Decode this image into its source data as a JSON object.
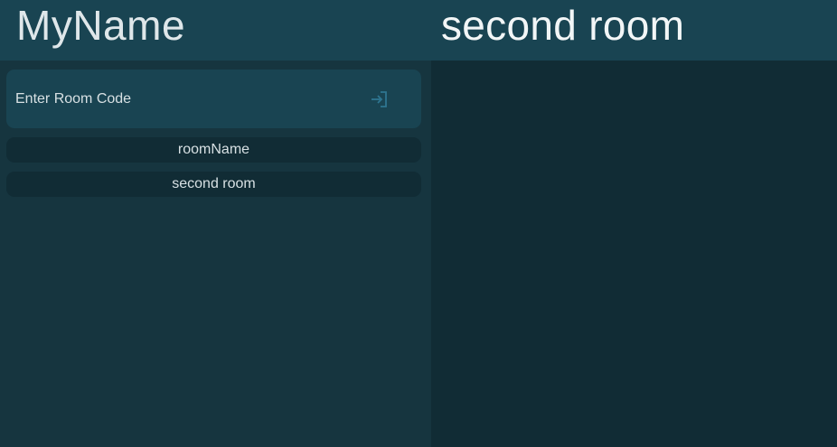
{
  "header": {
    "user_name": "MyName",
    "current_room": "second room"
  },
  "sidebar": {
    "room_code_input": {
      "placeholder": "Enter Room Code",
      "value": ""
    },
    "join_icon": "login-icon",
    "rooms": [
      {
        "label": "roomName"
      },
      {
        "label": "second room"
      }
    ]
  },
  "colors": {
    "header_bg": "#194452",
    "sidebar_bg": "#16353f",
    "chat_bg": "#112c35",
    "accent_icon": "#2e7590"
  }
}
